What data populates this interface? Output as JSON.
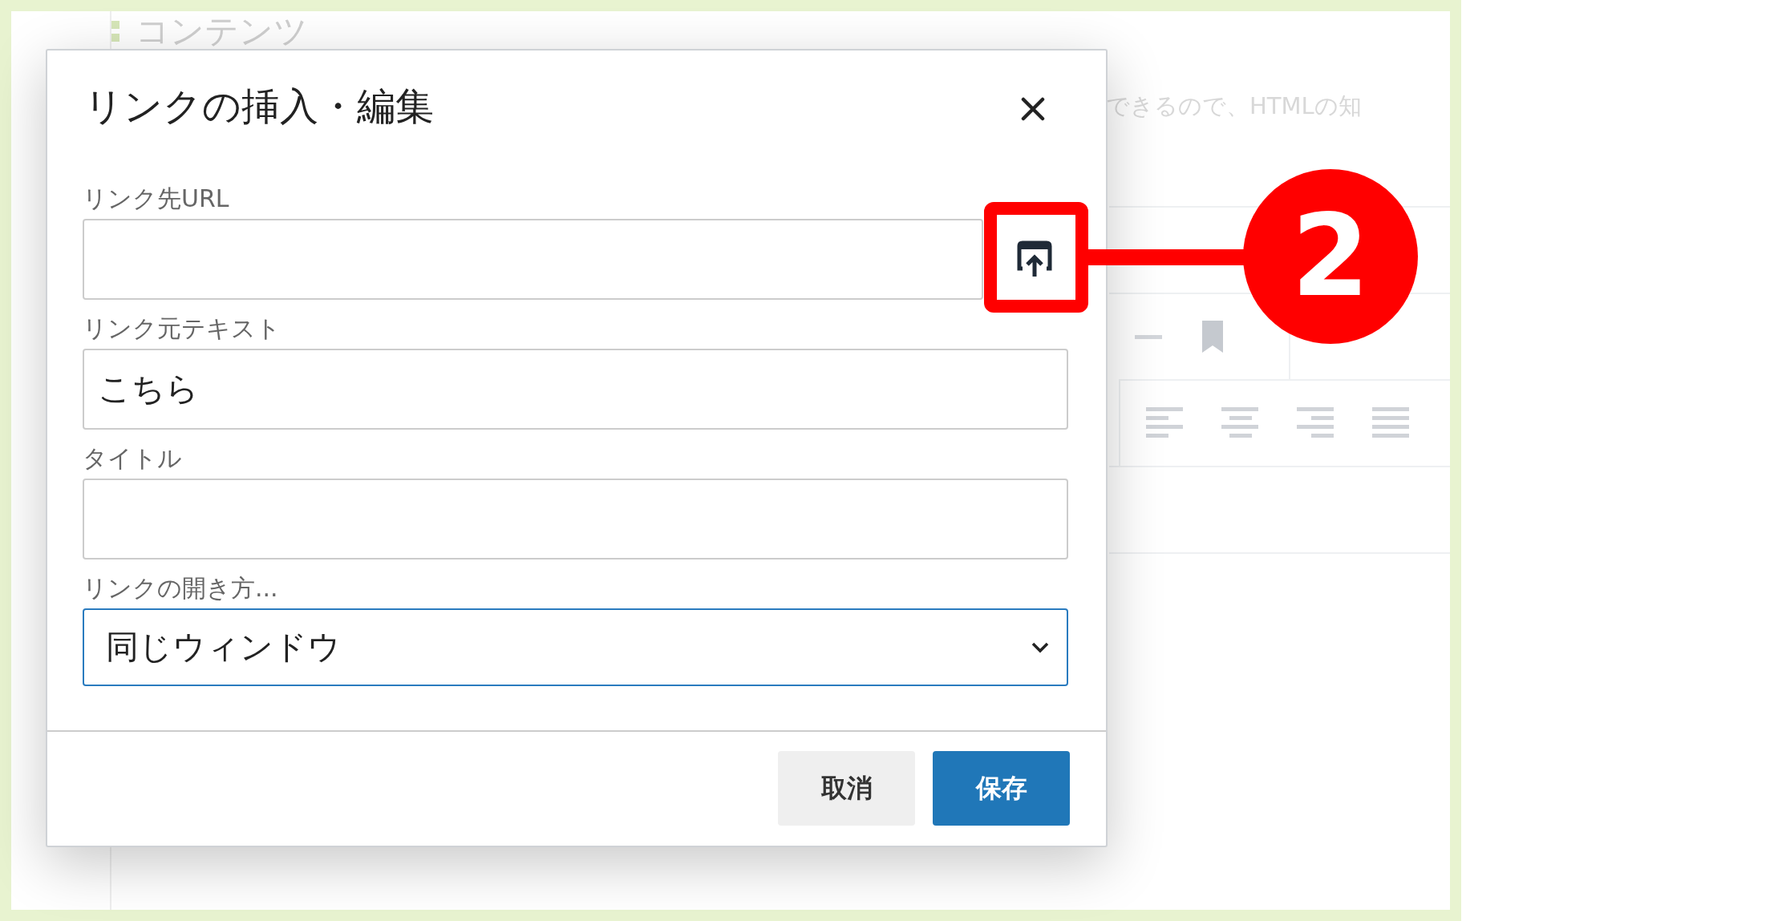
{
  "background": {
    "heading": "コンテンツ",
    "text": "できるので、HTMLの知"
  },
  "dialog": {
    "title": "リンクの挿入・編集",
    "fields": [
      {
        "kind": "url",
        "label": "リンク先URL",
        "focused": false
      },
      {
        "kind": "text",
        "label": "リンク元テキスト",
        "value": "こちら",
        "focused": false
      },
      {
        "kind": "text",
        "label": "タイトル",
        "focused": false
      },
      {
        "kind": "select",
        "label": "リンクの開き方...",
        "value": "同じウィンドウ",
        "focused": true
      }
    ],
    "buttons": [
      {
        "label": "取消",
        "kind": "secondary"
      },
      {
        "label": "保存",
        "kind": "primary"
      }
    ]
  },
  "callout": {
    "number": "2"
  }
}
